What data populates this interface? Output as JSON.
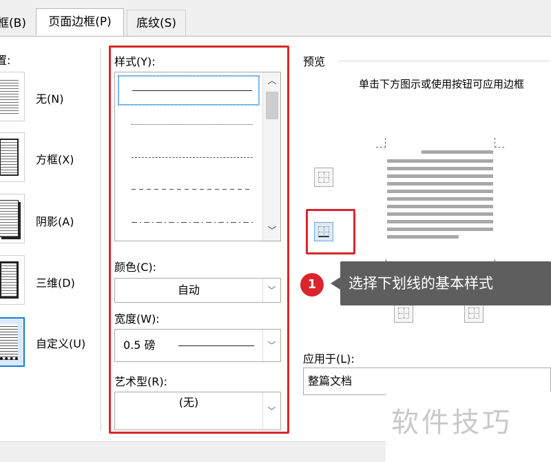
{
  "tabs": [
    {
      "label": "框(B)"
    },
    {
      "label": "页面边框(P)"
    },
    {
      "label": "底纹(S)"
    }
  ],
  "setting": {
    "heading": "置:",
    "items": [
      {
        "label": "无(N)"
      },
      {
        "label": "方框(X)"
      },
      {
        "label": "阴影(A)"
      },
      {
        "label": "三维(D)"
      },
      {
        "label": "自定义(U)"
      }
    ]
  },
  "style": {
    "label": "样式(Y):",
    "options": [
      "solid",
      "dotted",
      "dashed-small",
      "dashed",
      "dash-dot"
    ],
    "selected_index": 0
  },
  "color": {
    "label": "颜色(C):",
    "value": "自动"
  },
  "width": {
    "label": "宽度(W):",
    "value": "0.5 磅"
  },
  "art": {
    "label": "艺术型(R):",
    "value": "(无)"
  },
  "preview": {
    "label": "预览",
    "hint": "单击下方图示或使用按钮可应用边框"
  },
  "apply_to": {
    "label": "应用于(L):",
    "value": "整篇文档"
  },
  "annotation": {
    "step_number": "1",
    "text": "选择下划线的基本样式",
    "accent_color": "#d9252b",
    "tooltip_color": "#5e5e5e"
  },
  "watermark": "软件技巧",
  "icons": {
    "scroll_up": "chevron-up-icon",
    "scroll_down": "chevron-down-icon",
    "dropdown": "chevron-down-icon"
  }
}
